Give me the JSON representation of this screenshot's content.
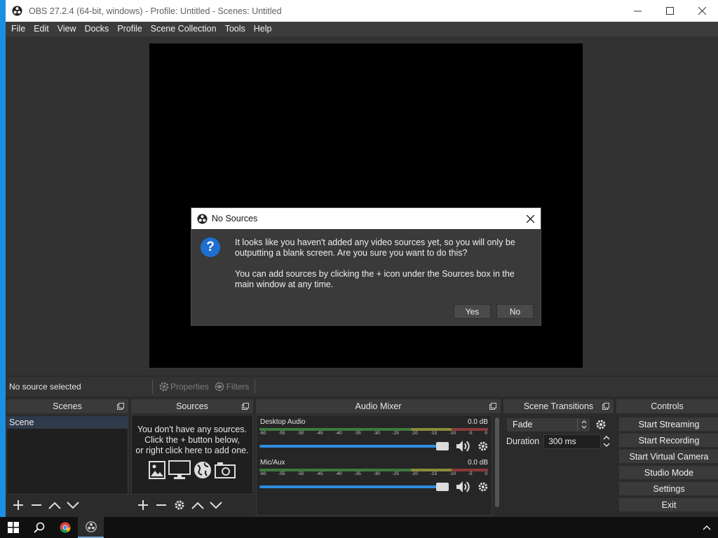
{
  "window": {
    "title": "OBS 27.2.4 (64-bit, windows) - Profile: Untitled - Scenes: Untitled"
  },
  "menu": [
    "File",
    "Edit",
    "View",
    "Docks",
    "Profile",
    "Scene Collection",
    "Tools",
    "Help"
  ],
  "source_bar": {
    "status": "No source selected",
    "properties_label": "Properties",
    "filters_label": "Filters"
  },
  "docks": {
    "scenes": {
      "title": "Scenes",
      "items": [
        "Scene"
      ]
    },
    "sources": {
      "title": "Sources",
      "empty_line1": "You don't have any sources.",
      "empty_line2": "Click the + button below,",
      "empty_line3": "or right click here to add one."
    },
    "mixer": {
      "title": "Audio Mixer",
      "tick_labels": [
        "-60",
        "-55",
        "-50",
        "-45",
        "-40",
        "-35",
        "-30",
        "-25",
        "-20",
        "-15",
        "-10",
        "-5",
        "0"
      ],
      "channels": [
        {
          "name": "Desktop Audio",
          "level": "0.0 dB",
          "volume": 1.0
        },
        {
          "name": "Mic/Aux",
          "level": "0.0 dB",
          "volume": 1.0
        }
      ]
    },
    "transitions": {
      "title": "Scene Transitions",
      "selected": "Fade",
      "duration_label": "Duration",
      "duration_value": "300 ms"
    },
    "controls": {
      "title": "Controls",
      "buttons": [
        "Start Streaming",
        "Start Recording",
        "Start Virtual Camera",
        "Studio Mode",
        "Settings",
        "Exit"
      ]
    }
  },
  "dialog": {
    "title": "No Sources",
    "icon": "question-icon",
    "message1": "It looks like you haven't added any video sources yet, so you will only be outputting a blank screen. Are you sure you want to do this?",
    "message2": "You can add sources by clicking the + icon under the Sources box in the main window at any time.",
    "yes_label": "Yes",
    "no_label": "No"
  },
  "colors": {
    "accent": "#2f8be0",
    "dialog_icon": "#1e6fd0",
    "desktop": "#1c8fe0"
  }
}
